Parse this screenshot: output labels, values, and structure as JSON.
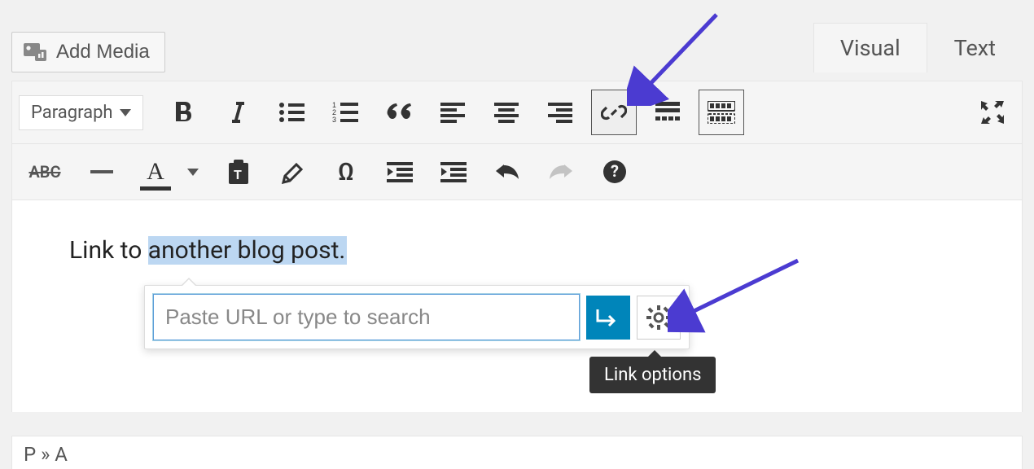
{
  "header": {
    "add_media_label": "Add Media"
  },
  "tabs": {
    "visual_label": "Visual",
    "text_label": "Text"
  },
  "toolbar": {
    "format_select": "Paragraph"
  },
  "content": {
    "text_prefix": "Link to ",
    "text_selected": "another blog post",
    "text_suffix": "."
  },
  "link_popup": {
    "placeholder": "Paste URL or type to search"
  },
  "tooltip": {
    "link_options": "Link options"
  },
  "footer": {
    "path": "P » A"
  }
}
